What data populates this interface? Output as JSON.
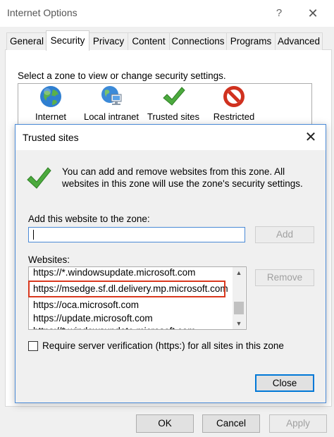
{
  "window": {
    "title": "Internet Options",
    "help": "?",
    "close": "✕"
  },
  "tabs": [
    "General",
    "Security",
    "Privacy",
    "Content",
    "Connections",
    "Programs",
    "Advanced"
  ],
  "active_tab": "Security",
  "security": {
    "prompt": "Select a zone to view or change security settings.",
    "zones": [
      {
        "label": "Internet",
        "icon": "globe-icon"
      },
      {
        "label": "Local intranet",
        "icon": "network-computer-icon"
      },
      {
        "label": "Trusted sites",
        "icon": "check-mark-icon"
      },
      {
        "label": "Restricted",
        "icon": "restricted-icon"
      }
    ]
  },
  "dialog": {
    "title": "Trusted sites",
    "close": "✕",
    "info": "You can add and remove websites from this zone. All websites in this zone will use the zone's security settings.",
    "add_label": "Add this website to the zone:",
    "add_value": "",
    "add_button": "Add",
    "websites_label": "Websites:",
    "sites": [
      "https://*.windowsupdate.microsoft.com",
      "https://msedge.sf.dl.delivery.mp.microsoft.com",
      "https://oca.microsoft.com",
      "https://update.microsoft.com",
      "https://*.windowsupdate.microsoft.com"
    ],
    "highlighted_site_index": 1,
    "remove_button": "Remove",
    "verify_label": "Require server verification (https:) for all sites in this zone",
    "verify_checked": false,
    "close_button": "Close"
  },
  "buttons": {
    "ok": "OK",
    "cancel": "Cancel",
    "apply": "Apply"
  },
  "colors": {
    "highlight": "#d9381e",
    "focus": "#0078d7",
    "check": "#3a9a3a",
    "restricted": "#d0311f"
  }
}
